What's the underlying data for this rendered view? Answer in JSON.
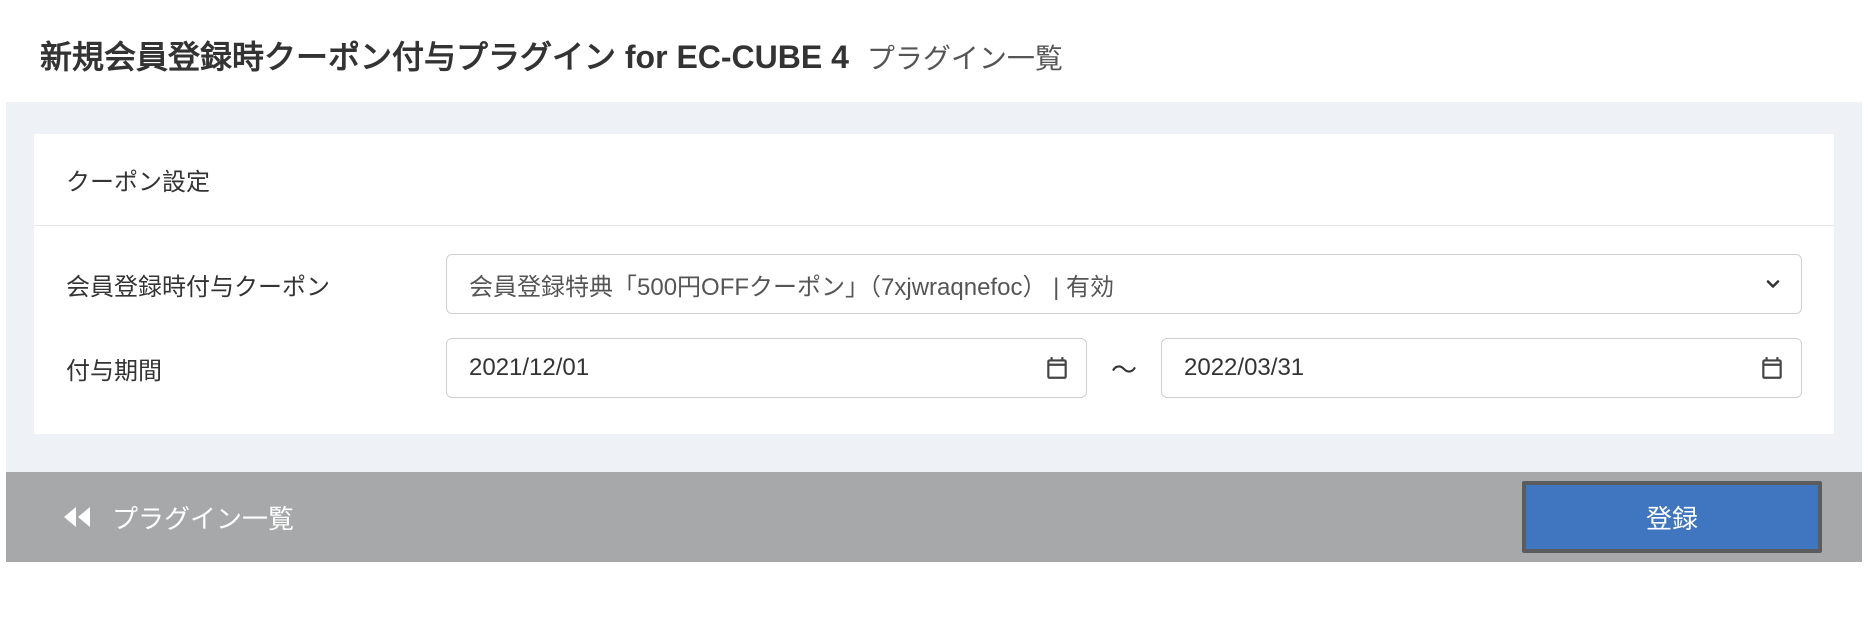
{
  "header": {
    "title": "新規会員登録時クーポン付与プラグイン for EC-CUBE 4",
    "subtitle": "プラグイン一覧"
  },
  "card": {
    "title": "クーポン設定"
  },
  "form": {
    "coupon_label": "会員登録時付与クーポン",
    "coupon_selected": "会員登録特典「500円OFFクーポン」（7xjwraqnefoc） | 有効",
    "period_label": "付与期間",
    "date_start": "2021/12/01",
    "range_separator": "〜",
    "date_end": "2022/03/31"
  },
  "footer": {
    "back_label": "プラグイン一覧",
    "submit_label": "登録"
  }
}
